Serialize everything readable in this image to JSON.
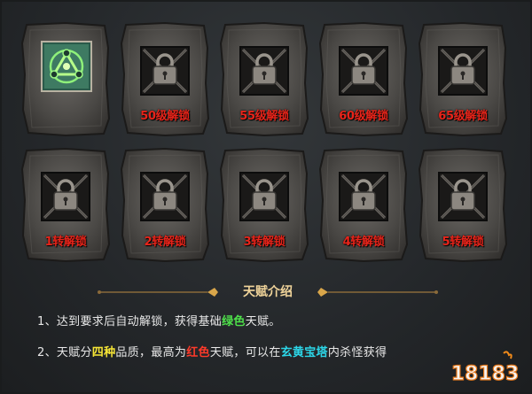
{
  "tiles_row1": [
    {
      "state": "unlocked",
      "icon": "green-talent-icon",
      "label": ""
    },
    {
      "state": "locked",
      "icon": "chained-lock-icon",
      "label": "50级解锁"
    },
    {
      "state": "locked",
      "icon": "chained-lock-icon",
      "label": "55级解锁"
    },
    {
      "state": "locked",
      "icon": "chained-lock-icon",
      "label": "60级解锁"
    },
    {
      "state": "locked",
      "icon": "chained-lock-icon",
      "label": "65级解锁"
    }
  ],
  "tiles_row2": [
    {
      "state": "locked",
      "icon": "chained-lock-icon",
      "label": "1转解锁"
    },
    {
      "state": "locked",
      "icon": "chained-lock-icon",
      "label": "2转解锁"
    },
    {
      "state": "locked",
      "icon": "chained-lock-icon",
      "label": "3转解锁"
    },
    {
      "state": "locked",
      "icon": "chained-lock-icon",
      "label": "4转解锁"
    },
    {
      "state": "locked",
      "icon": "chained-lock-icon",
      "label": "5转解锁"
    }
  ],
  "intro": {
    "title": "天赋介绍",
    "line1": {
      "prefix": "1、达到要求后自动解锁，获得基础",
      "green": "绿色",
      "suffix": "天赋。"
    },
    "line2": {
      "prefix": "2、天赋分",
      "yellow": "四种",
      "mid1": "品质，最高为",
      "red": "红色",
      "mid2": "天赋，可以在",
      "cyan": "玄黄宝塔",
      "suffix": "内杀怪获得"
    }
  },
  "watermark": {
    "text": "18183"
  },
  "colors": {
    "label_red": "#e8241a",
    "title_gold": "#f0d49a",
    "green": "#4ee04a",
    "yellow": "#f5e436",
    "red": "#ff3a2a",
    "cyan": "#2cd6e8"
  }
}
